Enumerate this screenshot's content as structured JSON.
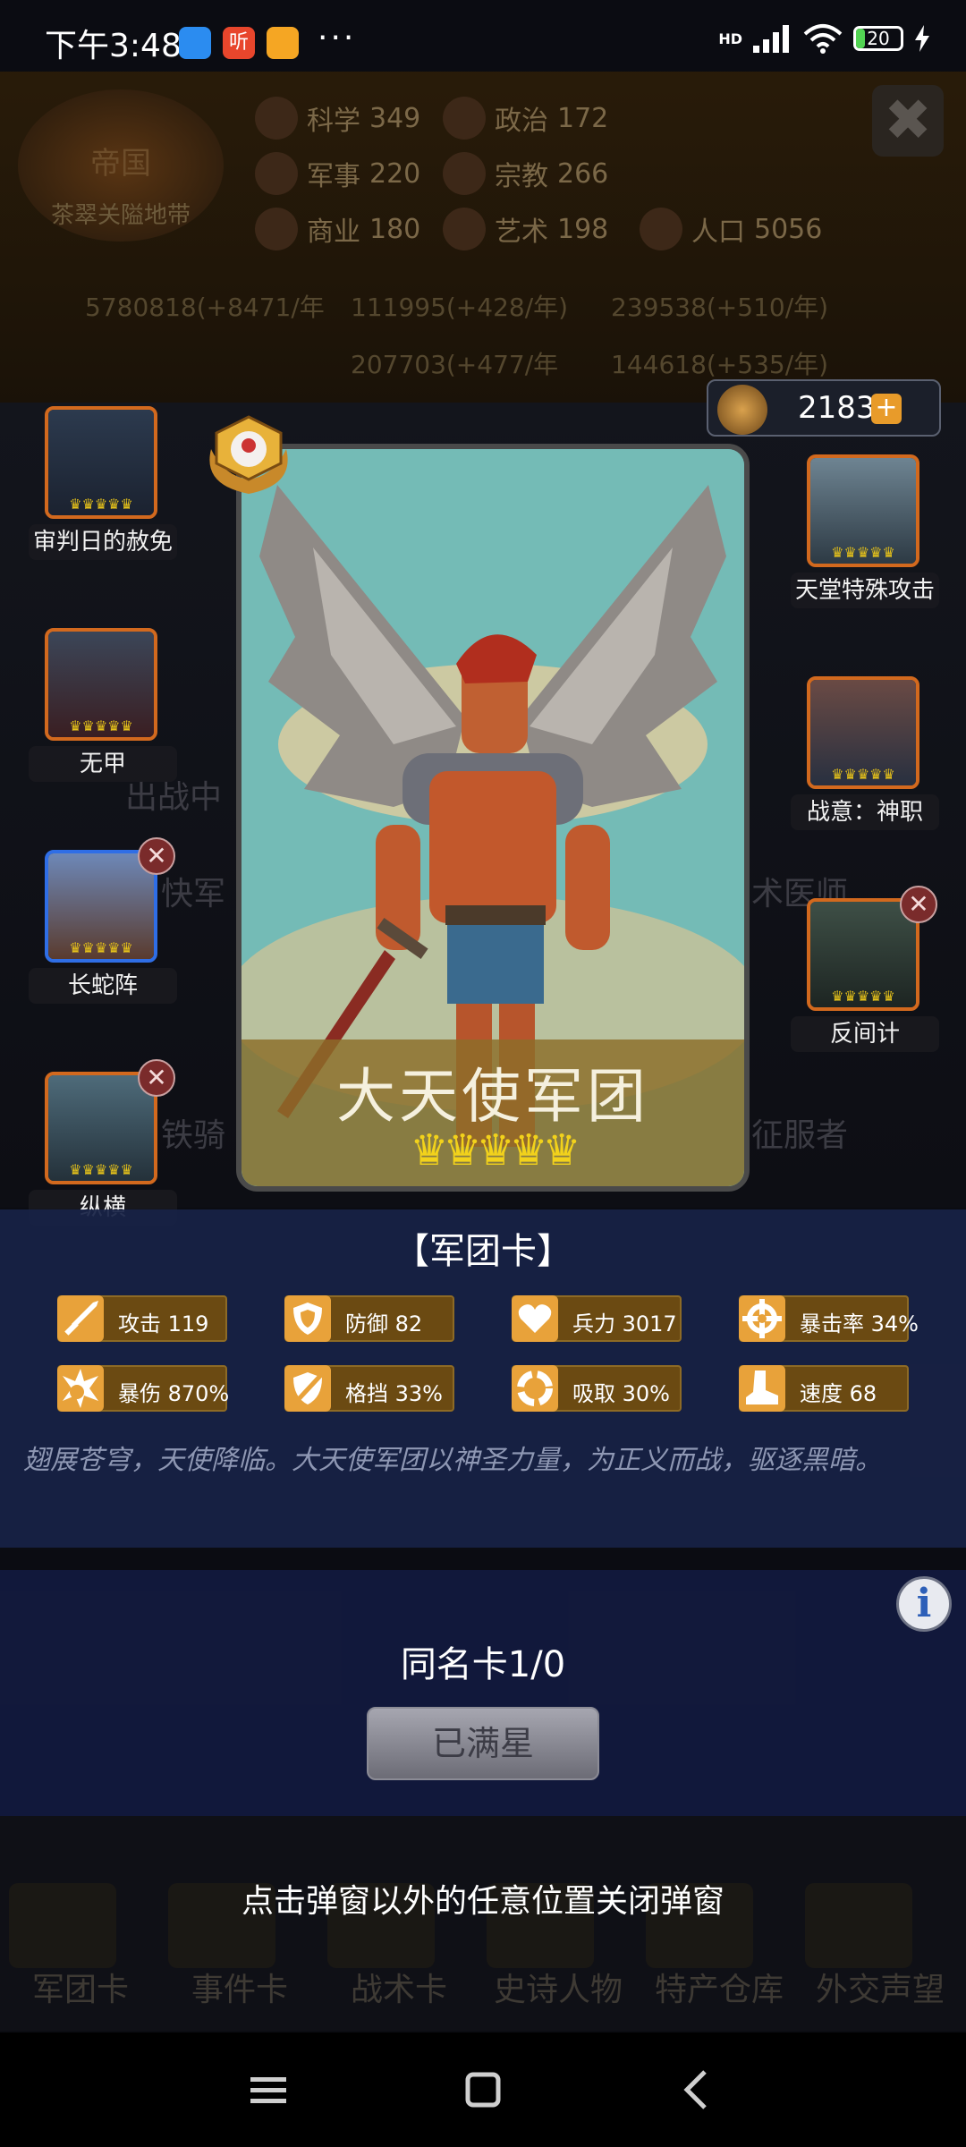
{
  "status_bar": {
    "time": "下午3:48",
    "notif_icons": [
      "blue-app-icon",
      "listen-app-icon",
      "orange-app-icon"
    ],
    "listen_glyph": "听",
    "more": "···",
    "network": "HD",
    "battery": "20",
    "battery_level": 0.2
  },
  "background": {
    "emblem_title": "帝国",
    "emblem_sub": "茶翠关隘地带",
    "stats": [
      {
        "label": "科学",
        "value": "349"
      },
      {
        "label": "政治",
        "value": "172"
      },
      {
        "label": "军事",
        "value": "220"
      },
      {
        "label": "宗教",
        "value": "266"
      },
      {
        "label": "商业",
        "value": "180"
      },
      {
        "label": "艺术",
        "value": "198"
      },
      {
        "label": "人口",
        "value": "5056"
      }
    ],
    "resources": [
      "5780818(+8471/年",
      "111995(+428/年)",
      "239538(+510/年)",
      "207703(+477/年",
      "144618(+535/年)"
    ],
    "ghost_texts": [
      "出战中",
      "快军",
      "术医师",
      "铁骑",
      "征服者"
    ],
    "bottom_tabs": [
      "军团卡",
      "事件卡",
      "战术卡",
      "史诗人物",
      "特产仓库",
      "外交声望"
    ]
  },
  "currency": {
    "value": "2183",
    "plus": "+"
  },
  "left_slots": [
    {
      "name": "审判日的赦免",
      "removable": false,
      "frame": "orange"
    },
    {
      "name": "无甲",
      "removable": false,
      "frame": "orange"
    },
    {
      "name": "长蛇阵",
      "removable": true,
      "frame": "blue"
    },
    {
      "name": "纵横",
      "removable": true,
      "frame": "orange"
    }
  ],
  "right_slots": [
    {
      "name": "天堂特殊攻击",
      "removable": false
    },
    {
      "name": "战意：神职",
      "removable": false
    },
    {
      "name": "反间计",
      "removable": true
    }
  ],
  "card": {
    "name": "大天使军团",
    "stars": 5,
    "type_title": "【军团卡】",
    "attributes": [
      {
        "label": "攻击 119",
        "icon": "sword-icon"
      },
      {
        "label": "防御 82",
        "icon": "shield-icon"
      },
      {
        "label": "兵力 3017",
        "icon": "heart-icon"
      },
      {
        "label": "暴击率 34%",
        "icon": "crosshair-icon"
      },
      {
        "label": "暴伤 870%",
        "icon": "burst-icon"
      },
      {
        "label": "格挡 33%",
        "icon": "block-shield-icon"
      },
      {
        "label": "吸取 30%",
        "icon": "drain-icon"
      },
      {
        "label": "速度 68",
        "icon": "boot-icon"
      }
    ],
    "description": "翅展苍穹，天使降临。大天使军团以神圣力量，为正义而战，驱逐黑暗。"
  },
  "upgrade": {
    "duplicate_count": "同名卡1/0",
    "button": "已满星",
    "info_glyph": "i"
  },
  "close_hint": "点击弹窗以外的任意位置关闭弹窗",
  "close_glyph": "✖",
  "colors": {
    "panel_bg": "#182246",
    "attribute_bg": "#6b4a12",
    "slot_frame": "#d2691e",
    "slot_frame_selected": "#2f6ee6",
    "crown": "#f2d21b"
  }
}
